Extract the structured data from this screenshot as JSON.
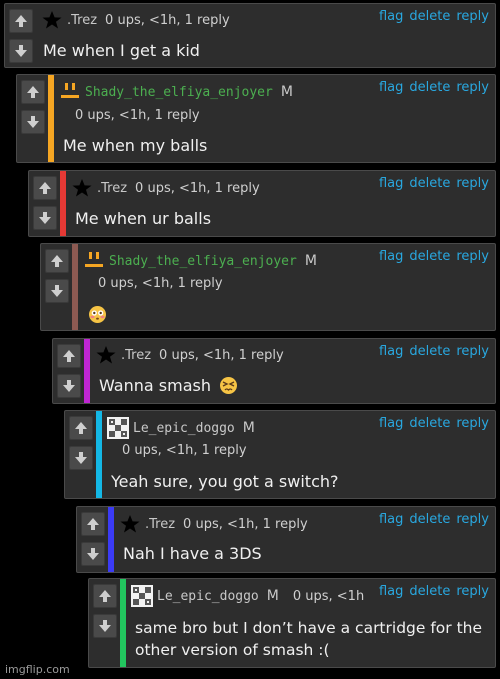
{
  "comments": [
    {
      "user": ".Trez",
      "meta": "0 ups, <1h, 1 reply",
      "text": "Me when I get a kid"
    },
    {
      "user": "Shady_the_elfiya_enjoyer",
      "mod": "M",
      "meta": "0 ups, <1h, 1 reply",
      "text": "Me when my balls"
    },
    {
      "user": ".Trez",
      "meta": "0 ups, <1h, 1 reply",
      "text": "Me when ur balls"
    },
    {
      "user": "Shady_the_elfiya_enjoyer",
      "mod": "M",
      "meta": "0 ups, <1h, 1 reply",
      "text": ""
    },
    {
      "user": ".Trez",
      "meta": "0 ups, <1h, 1 reply",
      "text": "Wanna smash"
    },
    {
      "user": "Le_epic_doggo",
      "mod": "M",
      "meta": "0 ups, <1h, 1 reply",
      "text": "Yeah sure, you got a switch?"
    },
    {
      "user": ".Trez",
      "meta": "0 ups, <1h, 1 reply",
      "text": "Nah I have a 3DS"
    },
    {
      "user": "Le_epic_doggo",
      "mod": "M",
      "meta": "0 ups, <1h",
      "text": "same bro but I don’t have a cartridge for the",
      "text2": "other version of smash :("
    }
  ],
  "actions": {
    "flag": "flag",
    "delete": "delete",
    "reply": "reply"
  },
  "colors": {
    "stripes": [
      "#f5a623",
      "#e53935",
      "#8d5a52",
      "#c026d3",
      "#14b8e6",
      "#3b3bf5",
      "#22c55e"
    ],
    "link": "#29a8e0",
    "username_green": "#4caf50"
  },
  "icons": {
    "up": "arrow-up-icon",
    "down": "arrow-down-icon",
    "star": "star-avatar-icon",
    "face": "orange-face-avatar-icon",
    "doggo": "pixel-doggo-avatar-icon"
  },
  "watermark": "imgflip.com"
}
